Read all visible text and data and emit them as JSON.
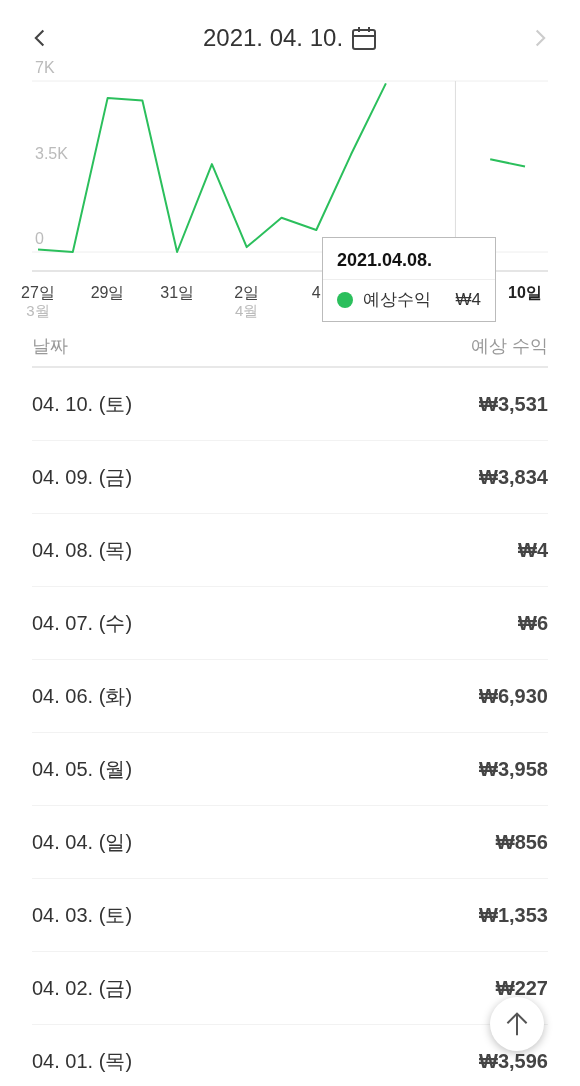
{
  "header": {
    "title": "2021. 04. 10.",
    "prev_disabled": false,
    "next_disabled": true
  },
  "chart": {
    "chart_data": {
      "type": "line",
      "categories": [
        "27일",
        null,
        "29일",
        null,
        "31일",
        null,
        "2일",
        null,
        "4",
        null,
        null,
        null,
        null,
        null,
        "10일"
      ],
      "series": [
        {
          "name": "예상수익",
          "color": "#2bbf5c",
          "values": [
            100,
            0,
            6300,
            6200,
            0,
            3600,
            200,
            1400,
            900,
            4000,
            6900,
            null,
            null,
            3800,
            3500
          ]
        }
      ],
      "ylim": [
        0,
        7000
      ],
      "yticks": [
        {
          "value": 0,
          "label": "0"
        },
        {
          "value": 3500,
          "label": "3.5K"
        },
        {
          "value": 7000,
          "label": "7K"
        }
      ]
    },
    "month_labels": [
      "3월",
      "4월"
    ],
    "tooltip": {
      "title": "2021.04.08.",
      "value": "₩4"
    }
  },
  "table": {
    "columns": [
      "날짜",
      "예상 수익"
    ],
    "rows": [
      {
        "date": "04. 10. (토)",
        "amount": "₩3,531"
      },
      {
        "date": "04. 09. (금)",
        "amount": "₩3,834"
      },
      {
        "date": "04. 08. (목)",
        "amount": "₩4"
      },
      {
        "date": "04. 07. (수)",
        "amount": "₩6"
      },
      {
        "date": "04. 06. (화)",
        "amount": "₩6,930"
      },
      {
        "date": "04. 05. (월)",
        "amount": "₩3,958"
      },
      {
        "date": "04. 04. (일)",
        "amount": "₩856"
      },
      {
        "date": "04. 03. (토)",
        "amount": "₩1,353"
      },
      {
        "date": "04. 02. (금)",
        "amount": "₩227"
      },
      {
        "date": "04. 01. (목)",
        "amount": "₩3,596"
      }
    ]
  }
}
